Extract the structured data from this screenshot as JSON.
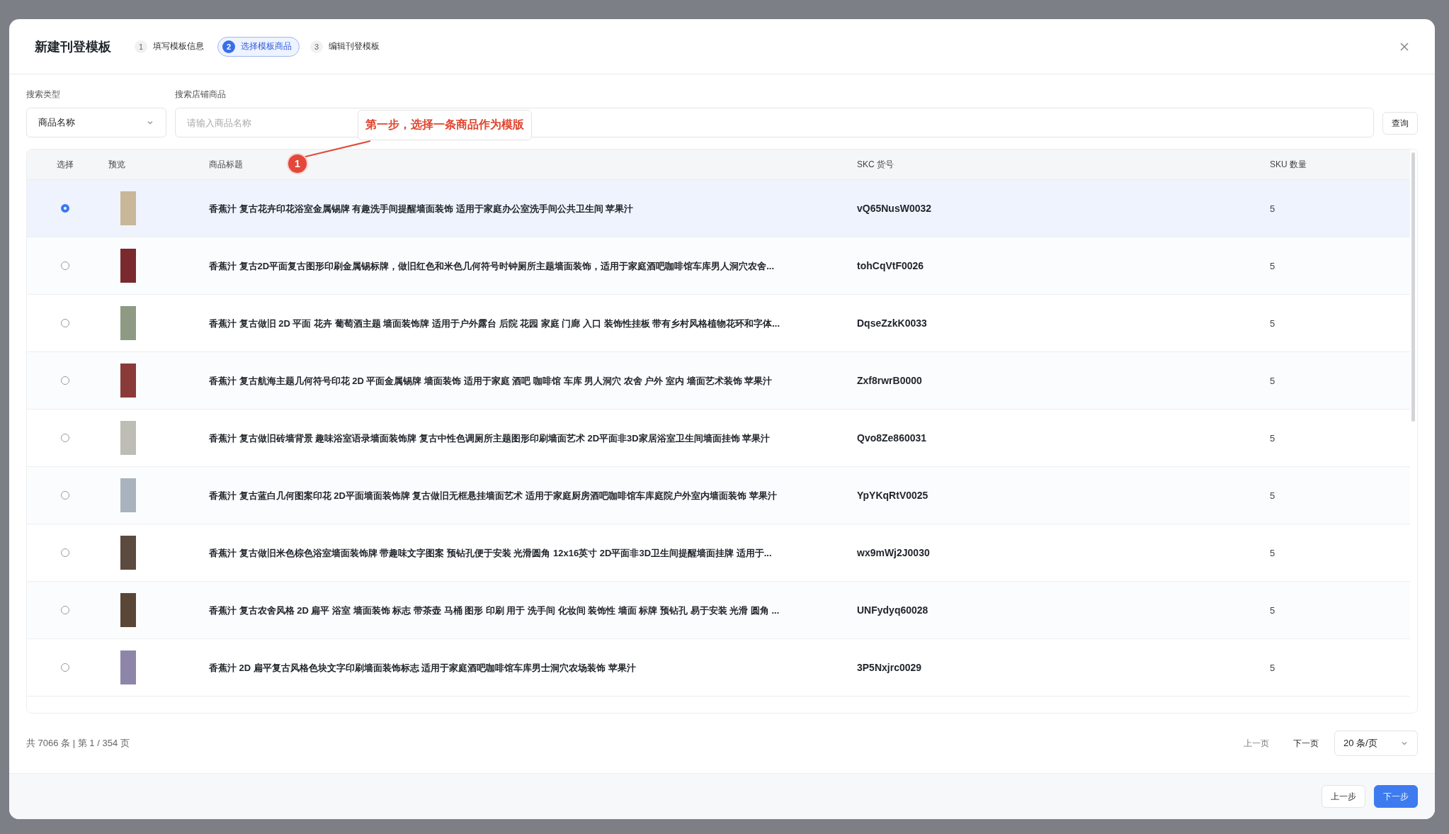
{
  "dialog": {
    "title": "新建刊登模板"
  },
  "steps": [
    {
      "number": "1",
      "label": "填写模板信息",
      "selected": false
    },
    {
      "number": "2",
      "label": "选择模板商品",
      "selected": true
    },
    {
      "number": "3",
      "label": "编辑刊登模板",
      "selected": false
    }
  ],
  "search": {
    "type_label": "搜索类型",
    "type_value": "商品名称",
    "query_label": "搜索店铺商品",
    "query_placeholder": "请输入商品名称",
    "button": "查询"
  },
  "annotation": {
    "number": "1",
    "text": "第一步，选择一条商品作为模版"
  },
  "table": {
    "columns": [
      "选择",
      "预览",
      "商品标题",
      "SKC 货号",
      "SKU 数量"
    ],
    "rows": [
      {
        "selected": true,
        "title": "香蕉汁 复古花卉印花浴室金属锡牌 有趣洗手间提醒墙面装饰 适用于家庭办公室洗手间公共卫生间 苹果汁",
        "skc": "vQ65NusW0032",
        "sku": "5"
      },
      {
        "selected": false,
        "title": "香蕉汁 复古2D平面复古图形印刷金属锡标牌，做旧红色和米色几何符号时钟厕所主题墙面装饰，适用于家庭酒吧咖啡馆车库男人洞穴农舍...",
        "skc": "tohCqVtF0026",
        "sku": "5"
      },
      {
        "selected": false,
        "title": "香蕉汁 复古做旧 2D 平面 花卉 葡萄酒主题 墙面装饰牌 适用于户外露台 后院 花园 家庭 门廊 入口 装饰性挂板 带有乡村风格植物花环和字体...",
        "skc": "DqseZzkK0033",
        "sku": "5"
      },
      {
        "selected": false,
        "title": "香蕉汁 复古航海主题几何符号印花 2D 平面金属锡牌 墙面装饰 适用于家庭 酒吧 咖啡馆 车库 男人洞穴 农舍 户外 室内 墙面艺术装饰 苹果汁",
        "skc": "Zxf8rwrB0000",
        "sku": "5"
      },
      {
        "selected": false,
        "title": "香蕉汁 复古做旧砖墙背景 趣味浴室语录墙面装饰牌 复古中性色调厕所主题图形印刷墙面艺术 2D平面非3D家居浴室卫生间墙面挂饰 苹果汁",
        "skc": "Qvo8Ze860031",
        "sku": "5"
      },
      {
        "selected": false,
        "title": "香蕉汁 复古蓝白几何图案印花 2D平面墙面装饰牌 复古做旧无框悬挂墙面艺术 适用于家庭厨房酒吧咖啡馆车库庭院户外室内墙面装饰 苹果汁",
        "skc": "YpYKqRtV0025",
        "sku": "5"
      },
      {
        "selected": false,
        "title": "香蕉汁 复古做旧米色棕色浴室墙面装饰牌 带趣味文字图案 预钻孔便于安装 光滑圆角 12x16英寸 2D平面非3D卫生间提醒墙面挂牌 适用于...",
        "skc": "wx9mWj2J0030",
        "sku": "5"
      },
      {
        "selected": false,
        "title": "香蕉汁 复古农舍风格 2D 扁平 浴室 墙面装饰 标志 带茶壶 马桶 图形 印刷 用于 洗手间 化妆间 装饰性 墙面 标牌 预钻孔 易于安装 光滑 圆角 ...",
        "skc": "UNFydyq60028",
        "sku": "5"
      },
      {
        "selected": false,
        "title": "香蕉汁 2D 扁平复古风格色块文字印刷墙面装饰标志 适用于家庭酒吧咖啡馆车库男士洞穴农场装饰 苹果汁",
        "skc": "3P5Nxjrc0029",
        "sku": "5"
      }
    ]
  },
  "pagination": {
    "summary": "共 7066 条 | 第 1 / 354 页",
    "prev": "上一页",
    "prev_disabled": true,
    "next": "下一页",
    "next_disabled": false,
    "page_size": "20 条/页"
  },
  "footer": {
    "back": "上一步",
    "next": "下一步"
  }
}
